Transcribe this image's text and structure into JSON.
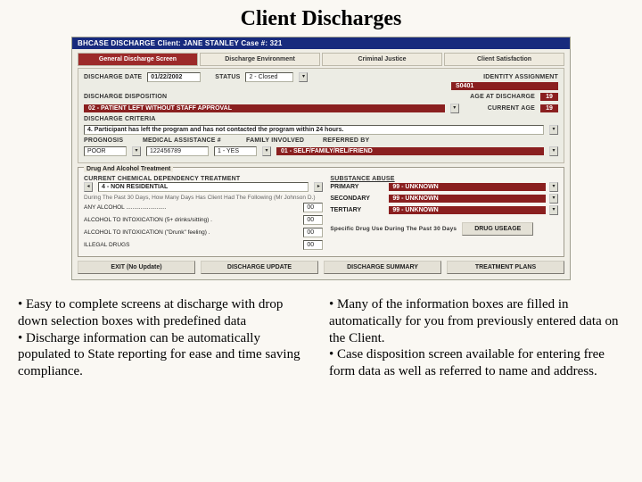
{
  "slide": {
    "title": "Client Discharges"
  },
  "titlebar": "BHCASE DISCHARGE    Client: JANE STANLEY   Case #:  321",
  "tabs": [
    "General Discharge Screen",
    "Discharge Environment",
    "Criminal Justice",
    "Client Satisfaction"
  ],
  "discharge": {
    "date_label": "DISCHARGE DATE",
    "date_value": "01/22/2002",
    "status_label": "STATUS",
    "status_value": "2 - Closed",
    "disposition_label": "DISCHARGE DISPOSITION",
    "disposition_value": "02 - PATIENT LEFT WITHOUT STAFF APPROVAL",
    "criteria_label": "DISCHARGE CRITERIA",
    "criteria_value": "4. Participant has left the program and has not contacted the program within 24 hours.",
    "identity_label": "IDENTITY ASSIGNMENT",
    "identity_value": "S0401",
    "age_discharge_label": "AGE AT DISCHARGE",
    "age_discharge_value": "19",
    "current_age_label": "CURRENT AGE",
    "current_age_value": "19",
    "prognosis_label": "PROGNOSIS",
    "prognosis_value": "POOR",
    "med_label": "MEDICAL ASSISTANCE #",
    "med_value": "122456789",
    "family_label": "FAMILY INVOLVED",
    "family_value": "1 - YES",
    "referred_label": "REFERRED BY",
    "referred_value": "01 - SELF/FAMILY/REL/FRIEND"
  },
  "treatment": {
    "panel_title": "Drug And Alcohol Treatment",
    "treatment_label": "CURRENT CHEMICAL DEPENDENCY TREATMENT",
    "treatment_value": "4 - NON RESIDENTIAL",
    "past30_label": "During The Past 30 Days, How Many Days Has Client Had The Following (Mr Johnson D.)",
    "any_alcohol_label": "ANY ALCOHOL .........................",
    "any_alcohol_value": "00",
    "intox1_label": "ALCOHOL TO INTOXICATION (5+ drinks/sitting) .",
    "intox1_value": "00",
    "intox2_label": "ALCOHOL TO INTOXICATION (\"Drunk\" feeling) .",
    "intox2_value": "00",
    "illegal_label": "ILLEGAL DRUGS",
    "illegal_value": "00",
    "substance_label": "SUBSTANCE ABUSE",
    "primary_label": "PRIMARY",
    "secondary_label": "SECONDARY",
    "tertiary_label": "TERTIARY",
    "unknown": "99 - UNKNOWN",
    "specific_label": "Specific Drug Use During The Past 30 Days",
    "drug_usage_btn": "DRUG USEAGE"
  },
  "buttons": {
    "exit": "EXIT (No Update)",
    "update": "DISCHARGE UPDATE",
    "summary": "DISCHARGE SUMMARY",
    "plans": "TREATMENT PLANS"
  },
  "bullets_left": "• Easy to complete screens at discharge with drop down selection boxes with predefined data\n• Discharge information can be automatically populated to State reporting for ease and time saving compliance.",
  "bullets_right": "• Many of the information boxes are filled in automatically for you from previously entered data on the Client.\n• Case disposition screen available for entering free form data as well as referred to name and address."
}
